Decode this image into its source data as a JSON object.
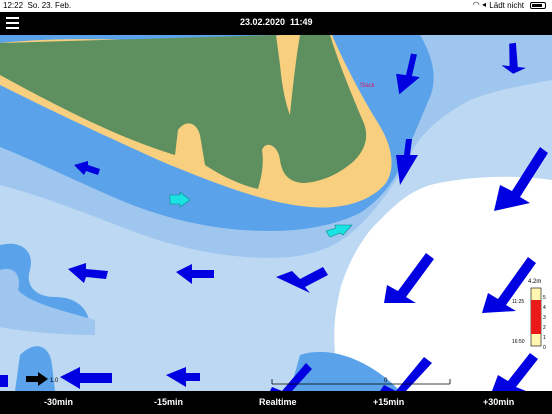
{
  "status_bar": {
    "time": "12:22",
    "date": "So. 23. Feb.",
    "charging": "Lädt nicht"
  },
  "header": {
    "date": "23.02.2020",
    "time": "11:49"
  },
  "map": {
    "place_label": "Slack",
    "scale_label_left": "1.0",
    "scale_label_right": "0",
    "gauge": {
      "max_label": "4.2m",
      "ticks": [
        "5",
        "4",
        "3",
        "2",
        "1",
        "0"
      ],
      "time_high": "11:25",
      "time_low": "16:50"
    }
  },
  "bottom_bar": {
    "buttons": [
      "-30min",
      "-15min",
      "Realtime",
      "+15min",
      "+30min"
    ]
  },
  "colors": {
    "land": "#5e8f5e",
    "sand": "#f7cf7f",
    "shallow": "#5aa3ea",
    "mid": "#9ec6ee",
    "deep": "#bcd8f2",
    "arrow": "#0000e0",
    "arrow_light": "#19e3e3"
  }
}
